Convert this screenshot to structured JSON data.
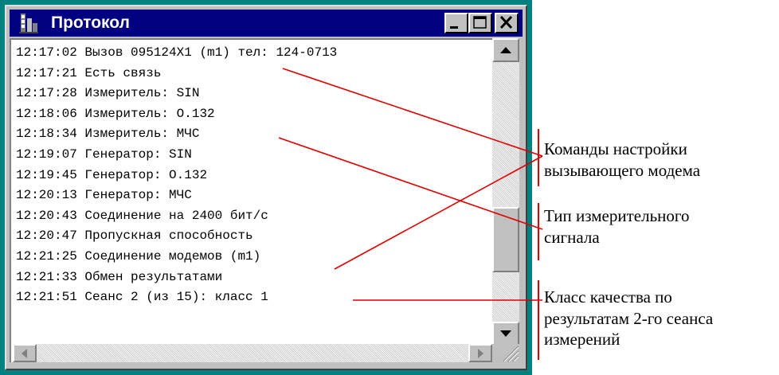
{
  "window": {
    "title": "Протокол",
    "icons": {
      "app": "app-icon",
      "minimize": "minimize-icon",
      "maximize": "maximize-icon",
      "close": "close-icon"
    }
  },
  "log": [
    "12:17:02 Вызов 095124X1 (m1) тел: 124-0713",
    "12:17:21 Есть связь",
    "12:17:28 Измеритель: SIN",
    "12:18:06 Измеритель: O.132",
    "12:18:34 Измеритель: МЧС",
    "12:19:07 Генератор: SIN",
    "12:19:45 Генератор: O.132",
    "12:20:13 Генератор: МЧС",
    "12:20:43 Соединение на 2400 бит/с",
    "12:20:47 Пропускная способность",
    "12:21:25 Соединение модемов (m1)",
    "12:21:33 Обмен результатами",
    "12:21:51 Сеанс 2 (из 15): класс 1"
  ],
  "annotations": [
    {
      "lines": [
        "Команды настройки",
        "вызывающего модема"
      ]
    },
    {
      "lines": [
        "Тип измерительного",
        "сигнала"
      ]
    },
    {
      "lines": [
        "Класс качества по",
        "результатам  2-го сеанса",
        "измерений"
      ]
    }
  ],
  "colors": {
    "desktop": "#008080",
    "titlebar": "#000080",
    "annotation_line": "#e00000"
  }
}
